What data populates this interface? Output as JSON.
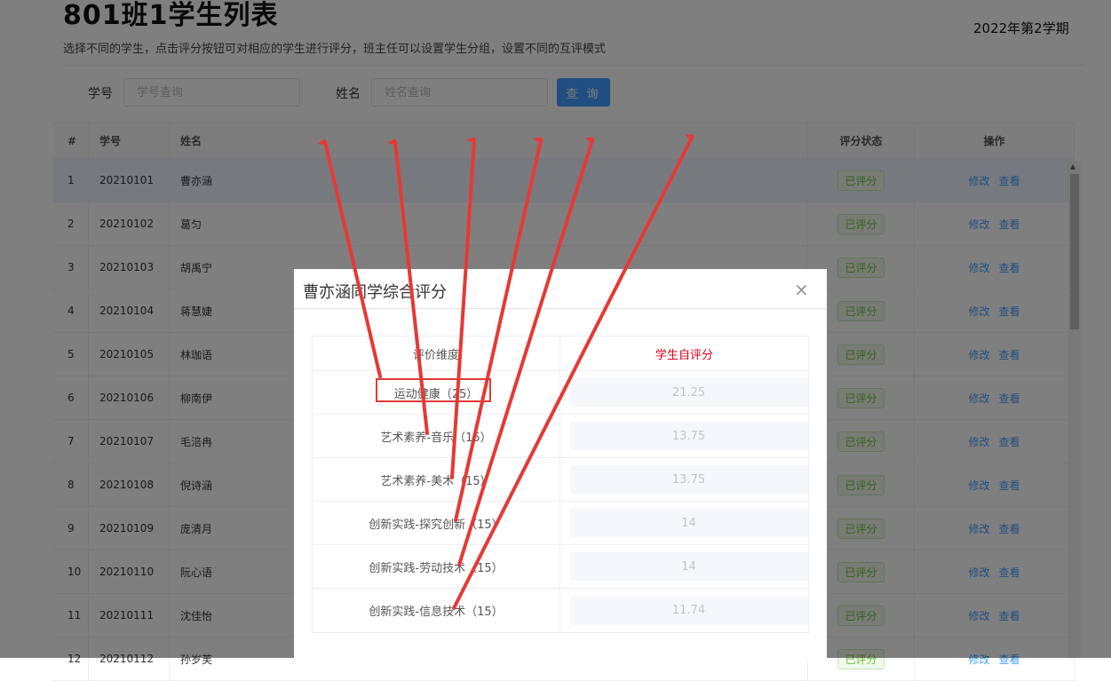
{
  "header": {
    "title": "801班1学生列表",
    "subtitle": "选择不同的学生，点击评分按钮可对相应的学生进行评分，班主任可以设置学生分组，设置不同的互评模式",
    "term": "2022年第2学期"
  },
  "search": {
    "id_label": "学号",
    "id_placeholder": "学号查询",
    "name_label": "姓名",
    "name_placeholder": "姓名查询",
    "button": "查 询"
  },
  "table": {
    "headers": [
      "#",
      "学号",
      "姓名",
      "评分状态",
      "操作"
    ],
    "rows": [
      {
        "no": "1",
        "id": "20210101",
        "name": "曹亦涵",
        "status": "已评分",
        "edit": "修改",
        "view": "查看"
      },
      {
        "no": "2",
        "id": "20210102",
        "name": "葛匀",
        "status": "已评分",
        "edit": "修改",
        "view": "查看"
      },
      {
        "no": "3",
        "id": "20210103",
        "name": "胡禹宁",
        "status": "已评分",
        "edit": "修改",
        "view": "查看"
      },
      {
        "no": "4",
        "id": "20210104",
        "name": "蒋慧婕",
        "status": "已评分",
        "edit": "修改",
        "view": "查看"
      },
      {
        "no": "5",
        "id": "20210105",
        "name": "林珈语",
        "status": "已评分",
        "edit": "修改",
        "view": "查看"
      },
      {
        "no": "6",
        "id": "20210106",
        "name": "柳南伊",
        "status": "已评分",
        "edit": "修改",
        "view": "查看"
      },
      {
        "no": "7",
        "id": "20210107",
        "name": "毛涪冉",
        "status": "已评分",
        "edit": "修改",
        "view": "查看"
      },
      {
        "no": "8",
        "id": "20210108",
        "name": "倪诗涵",
        "status": "已评分",
        "edit": "修改",
        "view": "查看"
      },
      {
        "no": "9",
        "id": "20210109",
        "name": "庞清月",
        "status": "已评分",
        "edit": "修改",
        "view": "查看"
      },
      {
        "no": "10",
        "id": "20210110",
        "name": "阮心语",
        "status": "已评分",
        "edit": "修改",
        "view": "查看"
      },
      {
        "no": "11",
        "id": "20210111",
        "name": "沈佳怡",
        "status": "已评分",
        "edit": "修改",
        "view": "查看"
      },
      {
        "no": "12",
        "id": "20210112",
        "name": "孙岁芙",
        "status": "已评分",
        "edit": "修改",
        "view": "查看"
      }
    ]
  },
  "dialog": {
    "title": "曹亦涵同学综合评分",
    "close": "×",
    "col_dimension": "评价维度",
    "col_self": "学生自评分",
    "items": [
      {
        "dimension": "运动健康（25）",
        "score": "21.25"
      },
      {
        "dimension": "艺术素养-音乐（15）",
        "score": "13.75"
      },
      {
        "dimension": "艺术素养-美术（15）",
        "score": "13.75"
      },
      {
        "dimension": "创新实践-探究创新（15）",
        "score": "14"
      },
      {
        "dimension": "创新实践-劳动技术（15）",
        "score": "14"
      },
      {
        "dimension": "创新实践-信息技术（15）",
        "score": "11.74"
      }
    ]
  },
  "colors": {
    "accent": "#409eff",
    "tag_green": "#67c23a",
    "annotation_red": "#e53935"
  }
}
